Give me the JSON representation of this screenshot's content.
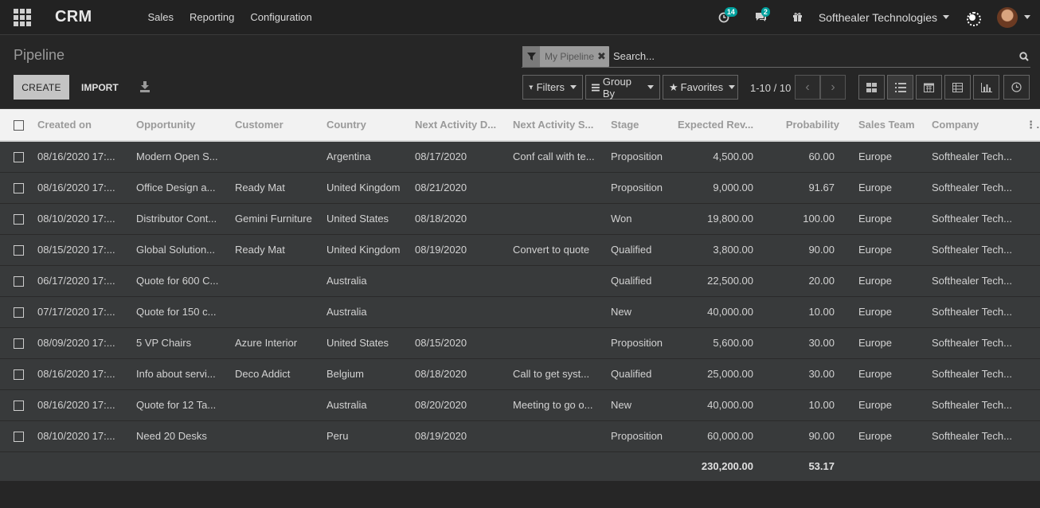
{
  "navbar": {
    "brand": "CRM",
    "menu": [
      "Sales",
      "Reporting",
      "Configuration"
    ],
    "activity_badge": "14",
    "messages_badge": "2",
    "company": "Softhealer Technologies"
  },
  "control": {
    "breadcrumb": "Pipeline",
    "create_label": "CREATE",
    "import_label": "IMPORT",
    "facet_label": "My Pipeline",
    "search_placeholder": "Search...",
    "filters_label": "Filters",
    "groupby_label": "Group By",
    "favorites_label": "Favorites",
    "pager": "1-10 / 10"
  },
  "table": {
    "columns": [
      "Created on",
      "Opportunity",
      "Customer",
      "Country",
      "Next Activity D...",
      "Next Activity S...",
      "Stage",
      "Expected Rev...",
      "Probability",
      "Sales Team",
      "Company"
    ],
    "rows": [
      [
        "08/16/2020 17:...",
        "Modern Open S...",
        "",
        "Argentina",
        "08/17/2020",
        "Conf call with te...",
        "Proposition",
        "4,500.00",
        "60.00",
        "Europe",
        "Softhealer Tech..."
      ],
      [
        "08/16/2020 17:...",
        "Office Design a...",
        "Ready Mat",
        "United Kingdom",
        "08/21/2020",
        "",
        "Proposition",
        "9,000.00",
        "91.67",
        "Europe",
        "Softhealer Tech..."
      ],
      [
        "08/10/2020 17:...",
        "Distributor Cont...",
        "Gemini Furniture",
        "United States",
        "08/18/2020",
        "",
        "Won",
        "19,800.00",
        "100.00",
        "Europe",
        "Softhealer Tech..."
      ],
      [
        "08/15/2020 17:...",
        "Global Solution...",
        "Ready Mat",
        "United Kingdom",
        "08/19/2020",
        "Convert to quote",
        "Qualified",
        "3,800.00",
        "90.00",
        "Europe",
        "Softhealer Tech..."
      ],
      [
        "06/17/2020 17:...",
        "Quote for 600 C...",
        "",
        "Australia",
        "",
        "",
        "Qualified",
        "22,500.00",
        "20.00",
        "Europe",
        "Softhealer Tech..."
      ],
      [
        "07/17/2020 17:...",
        "Quote for 150 c...",
        "",
        "Australia",
        "",
        "",
        "New",
        "40,000.00",
        "10.00",
        "Europe",
        "Softhealer Tech..."
      ],
      [
        "08/09/2020 17:...",
        "5 VP Chairs",
        "Azure Interior",
        "United States",
        "08/15/2020",
        "",
        "Proposition",
        "5,600.00",
        "30.00",
        "Europe",
        "Softhealer Tech..."
      ],
      [
        "08/16/2020 17:...",
        "Info about servi...",
        "Deco Addict",
        "Belgium",
        "08/18/2020",
        "Call to get syst...",
        "Qualified",
        "25,000.00",
        "30.00",
        "Europe",
        "Softhealer Tech..."
      ],
      [
        "08/16/2020 17:...",
        "Quote for 12 Ta...",
        "",
        "Australia",
        "08/20/2020",
        "Meeting to go o...",
        "New",
        "40,000.00",
        "10.00",
        "Europe",
        "Softhealer Tech..."
      ],
      [
        "08/10/2020 17:...",
        "Need 20 Desks",
        "",
        "Peru",
        "08/19/2020",
        "",
        "Proposition",
        "60,000.00",
        "90.00",
        "Europe",
        "Softhealer Tech..."
      ]
    ],
    "totals": {
      "expected_revenue": "230,200.00",
      "probability": "53.17"
    }
  }
}
